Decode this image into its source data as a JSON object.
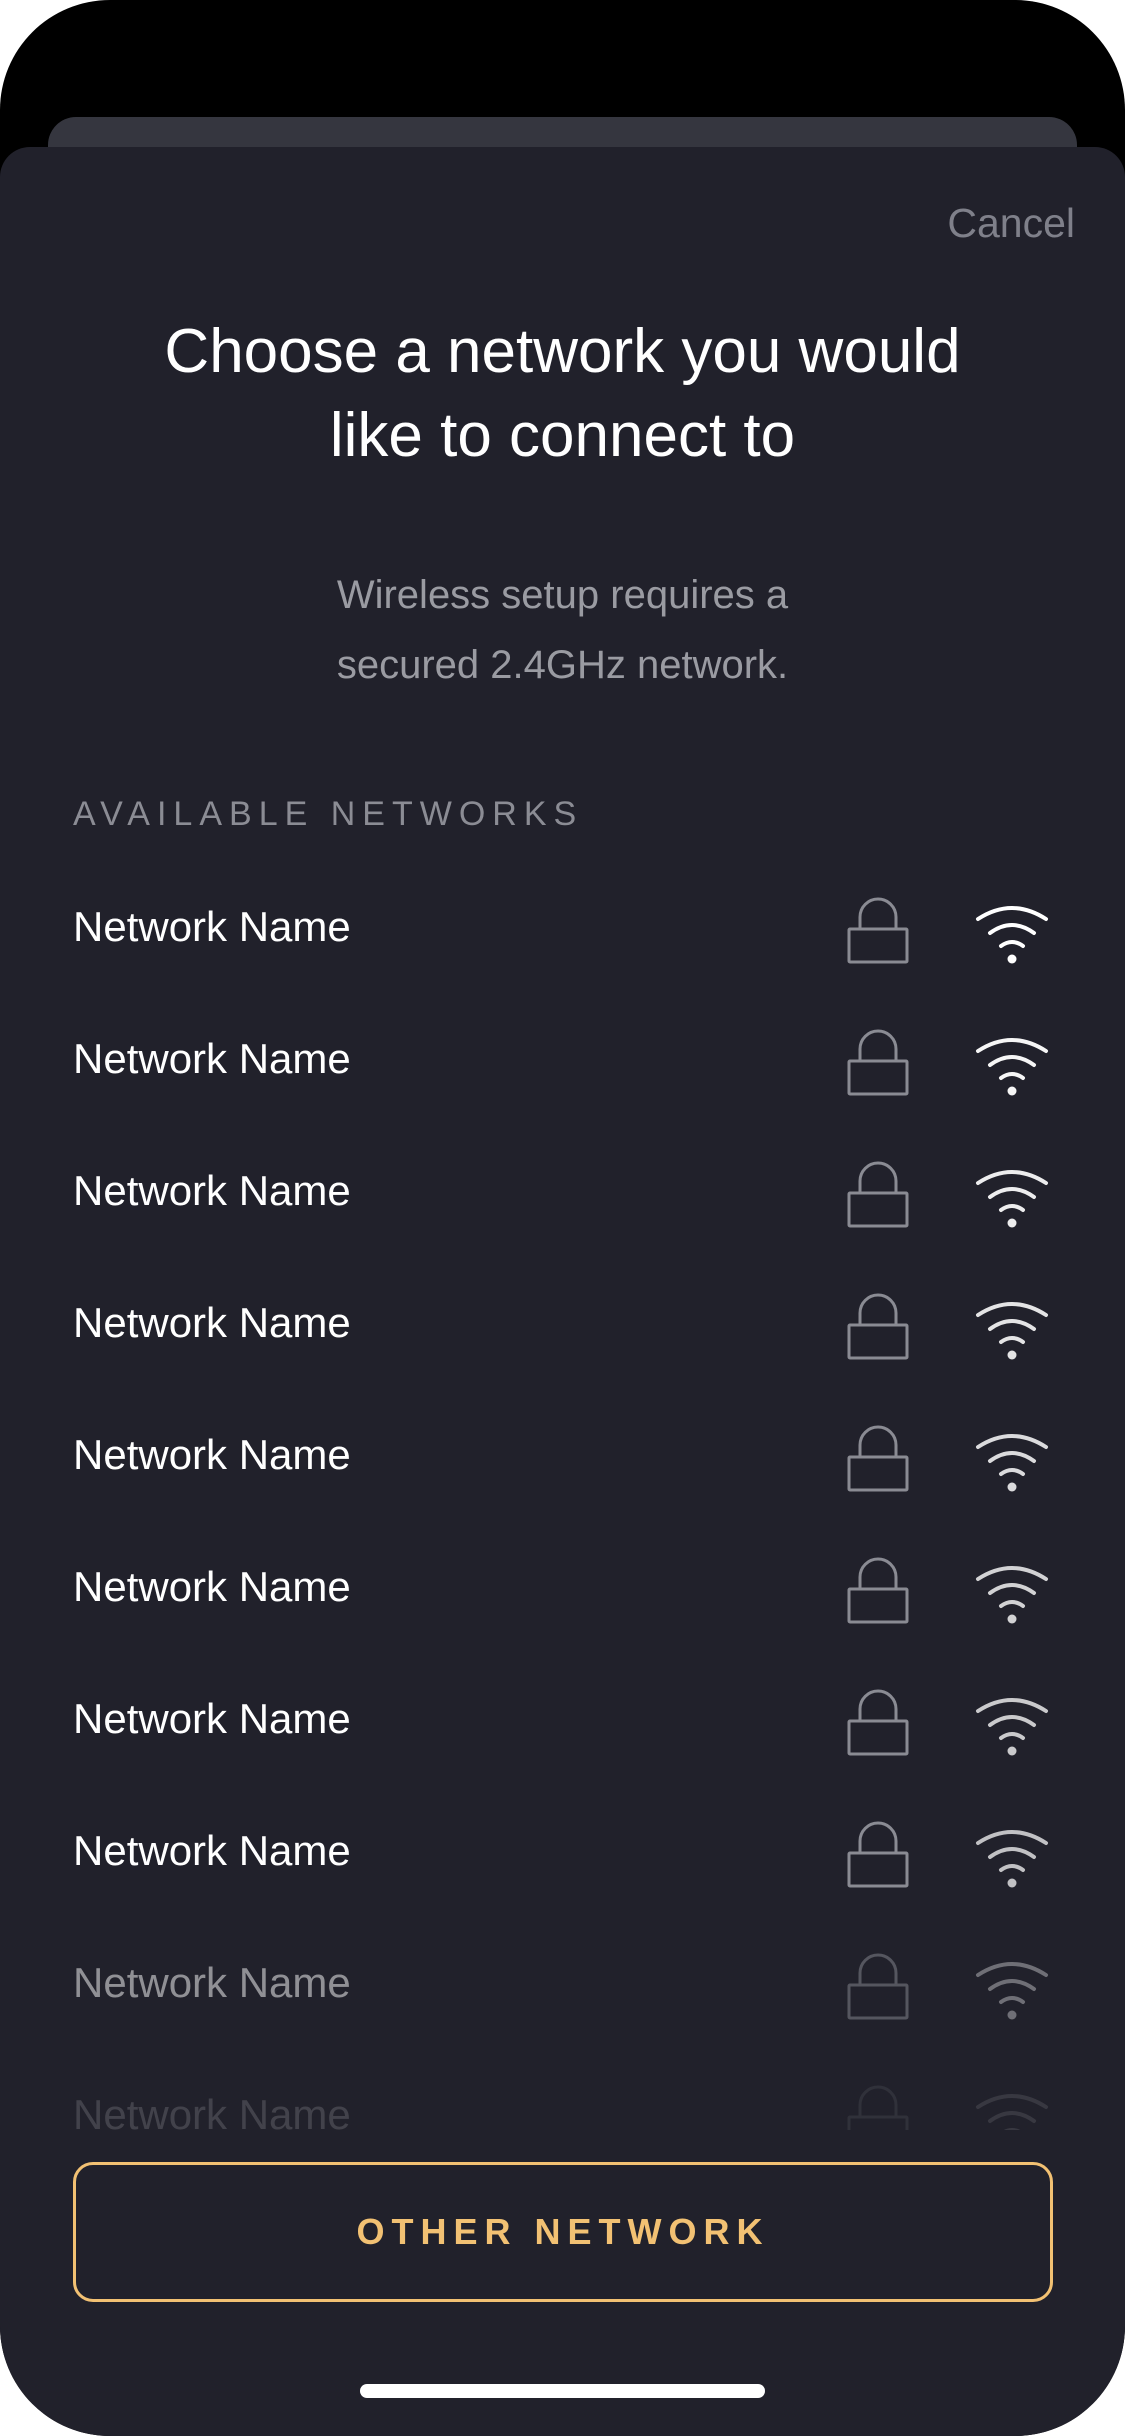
{
  "header": {
    "cancel_label": "Cancel"
  },
  "title": {
    "line1": "Choose a network you would",
    "line2": "like to connect to"
  },
  "subtitle": {
    "line1": "Wireless setup requires a",
    "line2": "secured 2.4GHz network."
  },
  "section_label": "AVAILABLE NETWORKS",
  "networks": [
    {
      "name": "Network Name",
      "secured": true,
      "icon": "wifi-icon"
    },
    {
      "name": "Network Name",
      "secured": true,
      "icon": "wifi-icon"
    },
    {
      "name": "Network Name",
      "secured": true,
      "icon": "wifi-icon"
    },
    {
      "name": "Network Name",
      "secured": true,
      "icon": "wifi-icon"
    },
    {
      "name": "Network Name",
      "secured": true,
      "icon": "wifi-icon"
    },
    {
      "name": "Network Name",
      "secured": true,
      "icon": "wifi-icon"
    },
    {
      "name": "Network Name",
      "secured": true,
      "icon": "wifi-icon"
    },
    {
      "name": "Network Name",
      "secured": true,
      "icon": "wifi-icon"
    },
    {
      "name": "Network Name",
      "secured": true,
      "icon": "wifi-icon"
    },
    {
      "name": "Network Name",
      "secured": true,
      "icon": "wifi-icon"
    }
  ],
  "other_network_label": "OTHER NETWORK",
  "colors": {
    "background": "#21212b",
    "accent": "#f2c173",
    "muted": "#7f808a"
  }
}
